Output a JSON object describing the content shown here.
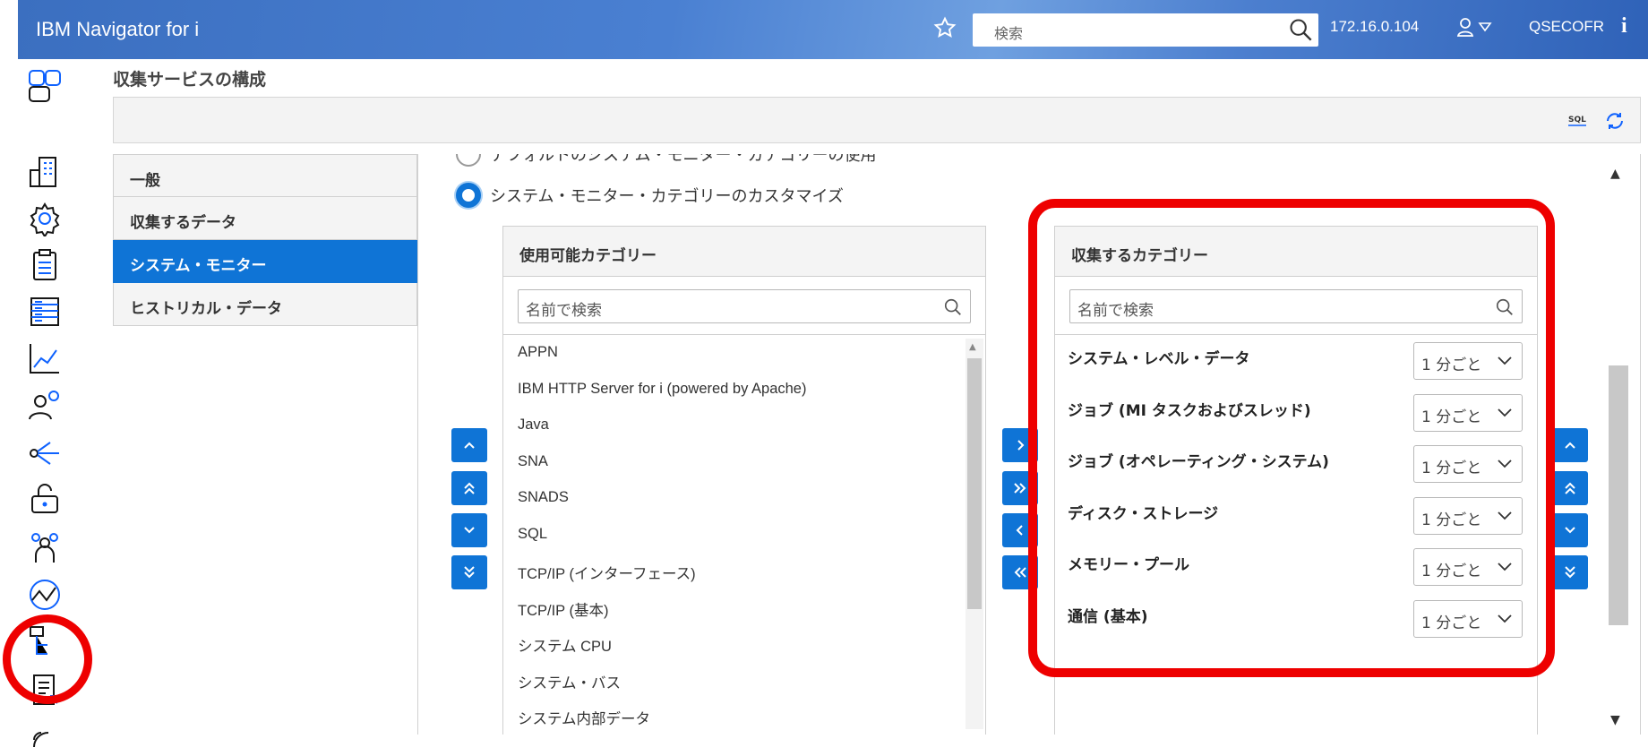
{
  "header": {
    "app_title": "IBM Navigator for i",
    "search_placeholder": "検索",
    "host_ip": "172.16.0.104",
    "user_name": "QSECOFR",
    "info_label": "i"
  },
  "page": {
    "title": "収集サービスの構成"
  },
  "nav": {
    "items": [
      {
        "label": "一般"
      },
      {
        "label": "収集するデータ"
      },
      {
        "label": "システム・モニター"
      },
      {
        "label": "ヒストリカル・データ"
      }
    ]
  },
  "options": {
    "default_label": "デフォルトのシステム・モニター・カテゴリーの使用",
    "custom_label": "システム・モニター・カテゴリーのカスタマイズ"
  },
  "available": {
    "title": "使用可能カテゴリー",
    "search_placeholder": "名前で検索",
    "items": [
      "APPN",
      "IBM HTTP Server for i (powered by Apache)",
      "Java",
      "SNA",
      "SNADS",
      "SQL",
      "TCP/IP (インターフェース)",
      "TCP/IP (基本)",
      "システム CPU",
      "システム・バス",
      "システム内部データ"
    ]
  },
  "collected": {
    "title": "収集するカテゴリー",
    "search_placeholder": "名前で検索",
    "items": [
      {
        "label": "システム・レベル・データ",
        "interval": "1 分ごと"
      },
      {
        "label": "ジョブ (MI タスクおよびスレッド)",
        "interval": "1 分ごと"
      },
      {
        "label": "ジョブ (オペレーティング・システム)",
        "interval": "1 分ごと"
      },
      {
        "label": "ディスク・ストレージ",
        "interval": "1 分ごと"
      },
      {
        "label": "メモリー・プール",
        "interval": "1 分ごと"
      },
      {
        "label": "通信 (基本)",
        "interval": "1 分ごと"
      }
    ]
  },
  "toolbar": {
    "sql_label": "SQL"
  },
  "colors": {
    "accent": "#0f74d6",
    "highlight": "#ee0000"
  }
}
